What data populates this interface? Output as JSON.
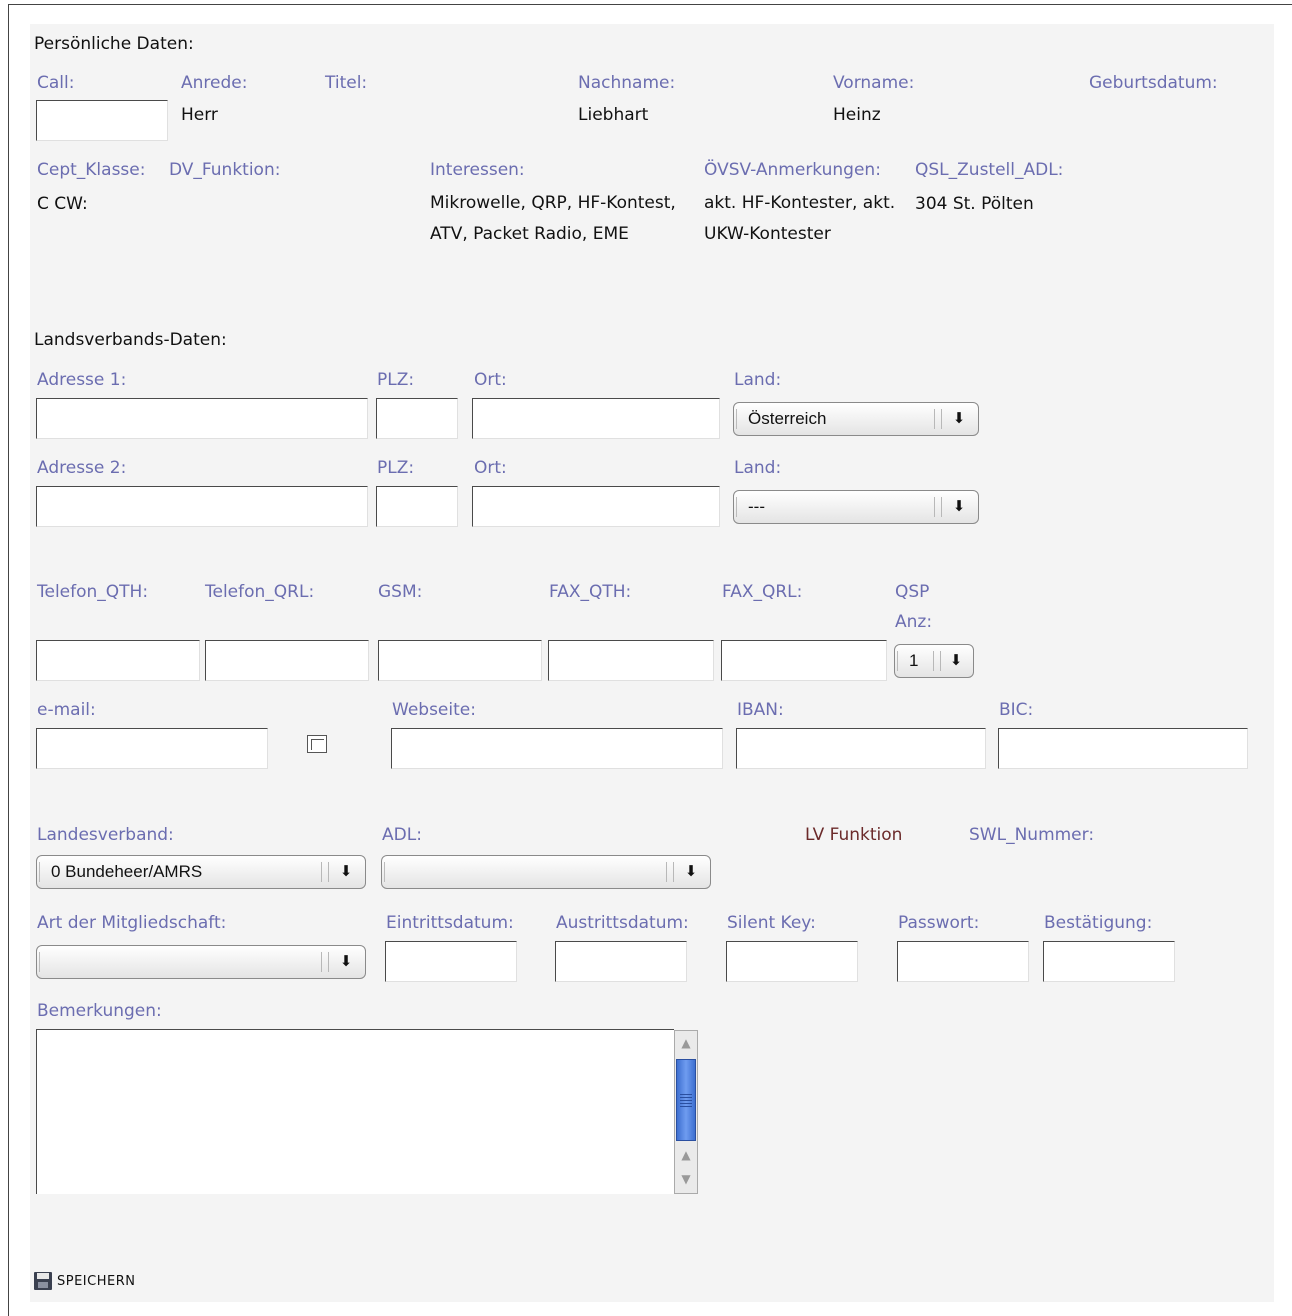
{
  "personal": {
    "section_title": "Persönliche Daten:",
    "call_label": "Call:",
    "anrede_label": "Anrede:",
    "anrede_value": "Herr",
    "titel_label": "Titel:",
    "nachname_label": "Nachname:",
    "nachname_value": "Liebhart",
    "vorname_label": "Vorname:",
    "vorname_value": "Heinz",
    "geburtsdatum_label": "Geburtsdatum:",
    "cept_label": "Cept_Klasse:",
    "cept_value": "C CW:",
    "dv_label": "DV_Funktion:",
    "interessen_label": "Interessen:",
    "interessen_value": "Mikrowelle, QRP, HF-Kontest, ATV, Packet Radio, EME",
    "oevsv_label": "ÖVSV-Anmerkungen:",
    "oevsv_value": "akt. HF-Kontester, akt. UKW-Kontester",
    "qsl_label": "QSL_Zustell_ADL:",
    "qsl_value": "304 St. Pölten"
  },
  "landesverband": {
    "section_title": "Landsverbands-Daten:",
    "adresse1_label": "Adresse 1:",
    "plz1_label": "PLZ:",
    "ort1_label": "Ort:",
    "land1_label": "Land:",
    "land1_value": "Österreich",
    "adresse2_label": "Adresse 2:",
    "plz2_label": "PLZ:",
    "ort2_label": "Ort:",
    "land2_label": "Land:",
    "land2_value": "---"
  },
  "contact": {
    "telefon_qth_label": "Telefon_QTH:",
    "telefon_qrl_label": "Telefon_QRL:",
    "gsm_label": "GSM:",
    "fax_qth_label": "FAX_QTH:",
    "fax_qrl_label": "FAX_QRL:",
    "qsp_label_1": "QSP",
    "qsp_label_2": "Anz:",
    "qsp_value": "1",
    "email_label": "e-mail:",
    "webseite_label": "Webseite:",
    "iban_label": "IBAN:",
    "bic_label": "BIC:"
  },
  "membership": {
    "landesverband_label": "Landesverband:",
    "landesverband_value": "0 Bundeheer/AMRS",
    "adl_label": "ADL:",
    "adl_value": "",
    "lv_funktion_label": "LV Funktion",
    "swl_label": "SWL_Nummer:",
    "art_label": "Art der Mitgliedschaft:",
    "art_value": "",
    "eintritt_label": "Eintrittsdatum:",
    "austritt_label": "Austrittsdatum:",
    "silentkey_label": "Silent Key:",
    "passwort_label": "Passwort:",
    "bestaetigung_label": "Bestätigung:",
    "bemerkungen_label": "Bemerkungen:"
  },
  "actions": {
    "save_label": "SPEICHERN"
  },
  "icons": {
    "dropdown": "arrow-down-icon",
    "save": "floppy-disk-icon"
  },
  "colors": {
    "label": "#6b6db0",
    "lv_funktion": "#6b2a2a",
    "panel_bg": "#f4f4f4",
    "scroll_thumb": "#4a7fe0"
  }
}
